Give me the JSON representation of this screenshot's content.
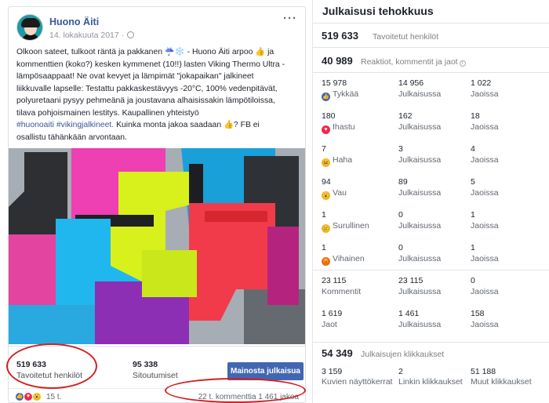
{
  "post": {
    "page_name": "Huono Äiti",
    "date": "14. lokakuuta 2017 ·",
    "more": "···",
    "text_lines": [
      "Olkoon sateet, tulkoot räntä ja pakkanen ☔❄️ - Huono Äiti arpoo 👍 ja",
      "kommenttien (koko?) kesken kymmenet (10!!) lasten Viking Thermo Ultra -",
      "lämpösaappaat! Ne ovat kevyet ja lämpimät \"jokapaikan\" jalkineet",
      "liikkuvalle lapselle: Testattu pakkaskestävyys -20°C, 100% vedenpitävät,",
      "polyuretaani pysyy pehmeänä ja joustavana alhaisissakin lämpötiloissa,",
      "tilava pohjoismainen lestitys. Kaupallinen yhteistyö"
    ],
    "hashtags": "#huonoaiti #vikingjalkineet.",
    "text_after_tags": " Kuinka monta jakoa saadaan 👍? FB ei",
    "text_last_line": "osallistu tähänkään arvontaan.",
    "reached_value": "519 633",
    "reached_label": "Tavoitetut henkilöt",
    "engagement_value": "95 338",
    "engagement_label": "Sitoutumiset",
    "promote_button": "Mainosta julkaisua",
    "reactions_count": "15 t.",
    "comments_shares": "22 t. kommenttia  1 461 jakoa"
  },
  "panel": {
    "title": "Julkaisusi tehokkuus",
    "reached_value": "519 633",
    "reached_label": "Tavoitetut henkilöt",
    "reactions_value": "40 989",
    "reactions_label": "Reaktiot, kommentit ja jaot",
    "rows": [
      {
        "icon": "like-icon",
        "color": "#4267b2",
        "glyph": "👍",
        "total": "15 978",
        "label": "Tykkää",
        "on_post": "14 956",
        "on_post_label": "Julkaisussa",
        "shares": "1 022",
        "shares_label": "Jaoissa"
      },
      {
        "icon": "love-icon",
        "color": "#f0284a",
        "glyph": "♥",
        "total": "180",
        "label": "Ihastu",
        "on_post": "162",
        "on_post_label": "Julkaisussa",
        "shares": "18",
        "shares_label": "Jaoissa"
      },
      {
        "icon": "haha-icon",
        "color": "#f7b125",
        "glyph": "😆",
        "total": "7",
        "label": "Haha",
        "on_post": "3",
        "on_post_label": "Julkaisussa",
        "shares": "4",
        "shares_label": "Jaoissa"
      },
      {
        "icon": "wow-icon",
        "color": "#f7b125",
        "glyph": "😮",
        "total": "94",
        "label": "Vau",
        "on_post": "89",
        "on_post_label": "Julkaisussa",
        "shares": "5",
        "shares_label": "Jaoissa"
      },
      {
        "icon": "sad-icon",
        "color": "#f7b125",
        "glyph": "😢",
        "total": "1",
        "label": "Surullinen",
        "on_post": "0",
        "on_post_label": "Julkaisussa",
        "shares": "1",
        "shares_label": "Jaoissa"
      },
      {
        "icon": "angry-icon",
        "color": "#e9710f",
        "glyph": "😡",
        "total": "1",
        "label": "Vihainen",
        "on_post": "0",
        "on_post_label": "Julkaisussa",
        "shares": "1",
        "shares_label": "Jaoissa"
      },
      {
        "icon": "",
        "color": "",
        "glyph": "",
        "total": "23 115",
        "label": "Kommentit",
        "on_post": "23 115",
        "on_post_label": "Julkaisussa",
        "shares": "0",
        "shares_label": "Jaoissa"
      },
      {
        "icon": "",
        "color": "",
        "glyph": "",
        "total": "1 619",
        "label": "Jaot",
        "on_post": "1 461",
        "on_post_label": "Julkaisussa",
        "shares": "158",
        "shares_label": "Jaoissa"
      }
    ],
    "clicks_value": "54 349",
    "clicks_label": "Julkaisujen klikkaukset",
    "clicks": [
      {
        "value": "3 159",
        "label": "Kuvien näyttökerrat"
      },
      {
        "value": "2",
        "label": "Linkin klikkaukset"
      },
      {
        "value": "51 188",
        "label": "Muut klikkaukset"
      }
    ]
  }
}
